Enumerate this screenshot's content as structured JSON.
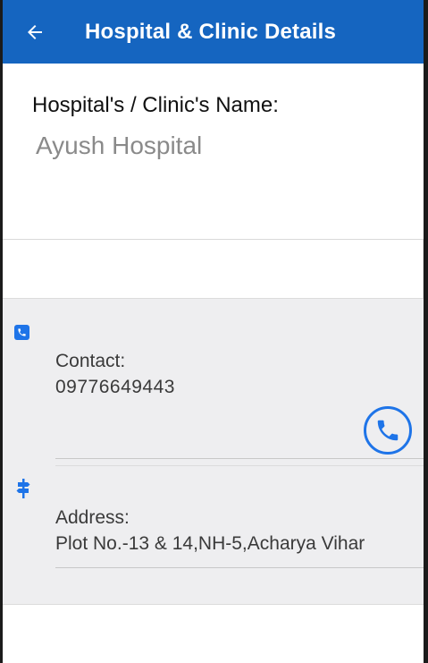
{
  "appbar": {
    "title": "Hospital & Clinic Details",
    "back_icon": "arrow-left-icon",
    "color": "#1565c0"
  },
  "hospital": {
    "name_label": "Hospital's / Clinic's Name:",
    "name_value": "Ayush Hospital"
  },
  "contact": {
    "icon": "phone-square-icon",
    "label": "Contact:",
    "value": "09776649443",
    "call_icon": "phone-circle-icon"
  },
  "address": {
    "icon": "signpost-icon",
    "label": "Address:",
    "value": "Plot No.-13 & 14,NH-5,Acharya Vihar"
  },
  "colors": {
    "accent": "#1e74e8",
    "card_background": "#eeeef0"
  }
}
